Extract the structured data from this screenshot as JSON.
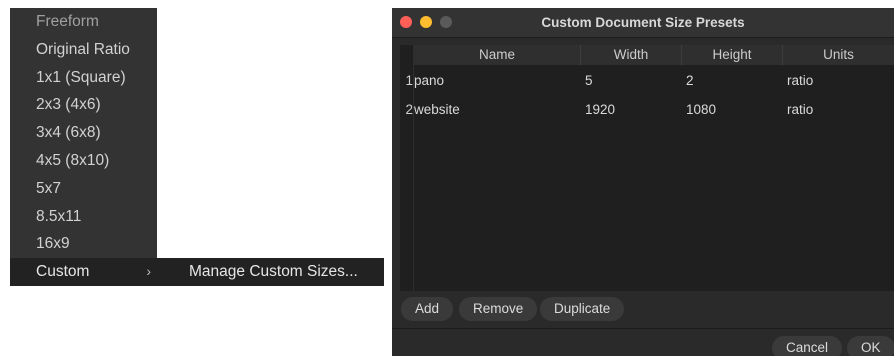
{
  "menu": {
    "items": [
      {
        "label": "Freeform"
      },
      {
        "label": "Original Ratio"
      },
      {
        "label": "1x1 (Square)"
      },
      {
        "label": "2x3 (4x6)"
      },
      {
        "label": "3x4 (6x8)"
      },
      {
        "label": "4x5 (8x10)"
      },
      {
        "label": "5x7"
      },
      {
        "label": "8.5x11"
      },
      {
        "label": "16x9"
      },
      {
        "label": "Custom",
        "has_submenu": true,
        "selected": true
      }
    ],
    "chevron": "›",
    "submenu": {
      "label": "Manage Custom Sizes..."
    }
  },
  "dialog": {
    "title": "Custom Document Size Presets",
    "columns": [
      "Name",
      "Width",
      "Height",
      "Units"
    ],
    "rows": [
      {
        "index": "1",
        "name": "pano",
        "width": "5",
        "height": "2",
        "units": "ratio"
      },
      {
        "index": "2",
        "name": "website",
        "width": "1920",
        "height": "1080",
        "units": "ratio"
      }
    ],
    "buttons": {
      "add": "Add",
      "remove": "Remove",
      "duplicate": "Duplicate"
    },
    "footer": {
      "cancel": "Cancel",
      "ok": "OK"
    }
  },
  "colors": {
    "close": "#fe5f57",
    "minimize": "#febc2e",
    "zoom_disabled": "#5a5a5a"
  }
}
